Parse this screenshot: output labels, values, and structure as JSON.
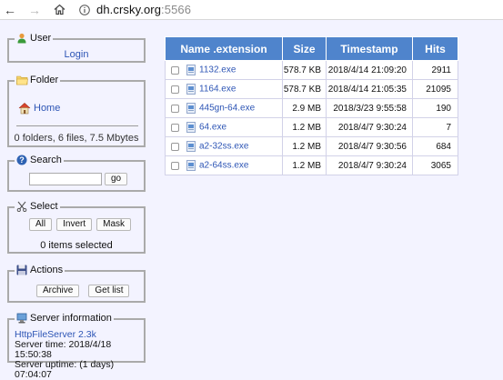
{
  "browser": {
    "url_host": "dh.crsky.org",
    "url_port": ":5566"
  },
  "user_panel": {
    "title": "User",
    "login_link": "Login"
  },
  "folder_panel": {
    "title": "Folder",
    "home_link": "Home",
    "summary": "0 folders, 6 files, 7.5 Mbytes"
  },
  "search_panel": {
    "title": "Search",
    "query_value": "",
    "go_label": "go"
  },
  "select_panel": {
    "title": "Select",
    "buttons": [
      "All",
      "Invert",
      "Mask"
    ],
    "status": "0 items selected"
  },
  "actions_panel": {
    "title": "Actions",
    "archive_label": "Archive",
    "getlist_label": "Get list"
  },
  "server_panel": {
    "title": "Server information",
    "server_link": "HttpFileServer 2.3k",
    "server_time": "Server time: 2018/4/18 15:50:38",
    "server_uptime": "Server uptime: (1 days) 07:04:07"
  },
  "file_table": {
    "headers": {
      "name": "Name .extension",
      "size": "Size",
      "timestamp": "Timestamp",
      "hits": "Hits"
    },
    "rows": [
      {
        "name": "1132.exe",
        "size": "578.7 KB",
        "timestamp": "2018/4/14 21:09:20",
        "hits": "2911"
      },
      {
        "name": "1164.exe",
        "size": "578.7 KB",
        "timestamp": "2018/4/14 21:05:35",
        "hits": "21095"
      },
      {
        "name": "445gn-64.exe",
        "size": "2.9 MB",
        "timestamp": "2018/3/23 9:55:58",
        "hits": "190"
      },
      {
        "name": "64.exe",
        "size": "1.2 MB",
        "timestamp": "2018/4/7 9:30:24",
        "hits": "7"
      },
      {
        "name": "a2-32ss.exe",
        "size": "1.2 MB",
        "timestamp": "2018/4/7 9:30:56",
        "hits": "684"
      },
      {
        "name": "a2-64ss.exe",
        "size": "1.2 MB",
        "timestamp": "2018/4/7 9:30:24",
        "hits": "3065"
      }
    ]
  },
  "colors": {
    "header_bg": "#4f84cc",
    "link": "#2d55b5",
    "page_bg": "#f3f3ff",
    "panel_border": "#aaaaaa"
  }
}
